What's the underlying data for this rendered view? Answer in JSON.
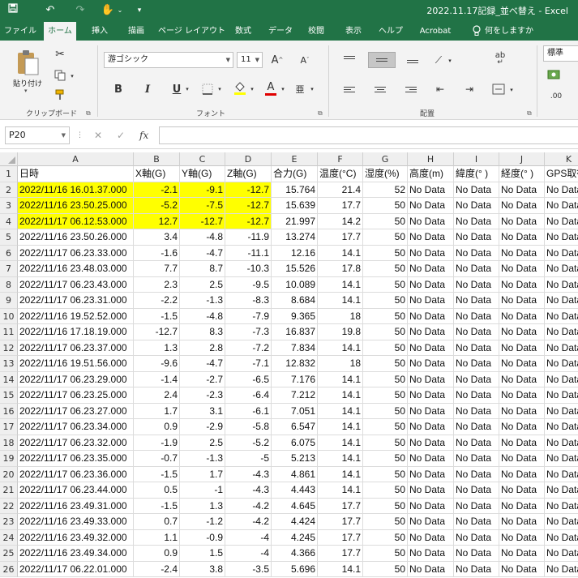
{
  "window": {
    "title": "2022.11.17記録_並べ替え  -  Excel",
    "qat": [
      "save-icon",
      "undo-icon",
      "redo-icon",
      "touch-mode-icon",
      "customize-qat-icon"
    ]
  },
  "ribbon": {
    "tabs": [
      "ファイル",
      "ホーム",
      "挿入",
      "描画",
      "ページ レイアウト",
      "数式",
      "データ",
      "校閲",
      "表示",
      "ヘルプ",
      "Acrobat",
      "何をしますか"
    ],
    "active_tab": "ホーム",
    "clipboard": {
      "label": "クリップボード",
      "paste_label": "貼り付け"
    },
    "font": {
      "label": "フォント",
      "name": "游ゴシック",
      "size": "11",
      "bold": "B",
      "italic": "I",
      "underline": "U",
      "grow": "A",
      "shrink": "A",
      "font_color": "A",
      "phonetic": "亜"
    },
    "alignment": {
      "label": "配置",
      "wrap": "ab",
      "merge": "⇔"
    },
    "number": {
      "format": "標準",
      "decimal": ".00"
    }
  },
  "formula_bar": {
    "name_box": "P20",
    "cancel": "✕",
    "enter": "✓",
    "fx": "fx",
    "value": ""
  },
  "sheet": {
    "columns": [
      "A",
      "B",
      "C",
      "D",
      "E",
      "F",
      "G",
      "H",
      "I",
      "J",
      "K"
    ],
    "headers": [
      "日時",
      "X軸(G)",
      "Y軸(G)",
      "Z軸(G)",
      "合力(G)",
      "温度(°C)",
      "湿度(%)",
      "高度(m)",
      "緯度(° )",
      "経度(° )",
      "GPS取得"
    ],
    "highlight_color": "#ffff00",
    "rows": [
      {
        "n": "2",
        "hl": true,
        "c": [
          "2022/11/16 16.01.37.000",
          "-2.1",
          "-9.1",
          "-12.7",
          "15.764",
          "21.4",
          "52",
          "No Data",
          "No Data",
          "No Data",
          "No Data"
        ]
      },
      {
        "n": "3",
        "hl": true,
        "c": [
          "2022/11/16 23.50.25.000",
          "-5.2",
          "-7.5",
          "-12.7",
          "15.639",
          "17.7",
          "50",
          "No Data",
          "No Data",
          "No Data",
          "No Data"
        ]
      },
      {
        "n": "4",
        "hl": true,
        "c": [
          "2022/11/17 06.12.53.000",
          "12.7",
          "-12.7",
          "-12.7",
          "21.997",
          "14.2",
          "50",
          "No Data",
          "No Data",
          "No Data",
          "No Data"
        ]
      },
      {
        "n": "5",
        "hl": false,
        "c": [
          "2022/11/16 23.50.26.000",
          "3.4",
          "-4.8",
          "-11.9",
          "13.274",
          "17.7",
          "50",
          "No Data",
          "No Data",
          "No Data",
          "No Data"
        ]
      },
      {
        "n": "6",
        "hl": false,
        "c": [
          "2022/11/17 06.23.33.000",
          "-1.6",
          "-4.7",
          "-11.1",
          "12.16",
          "14.1",
          "50",
          "No Data",
          "No Data",
          "No Data",
          "No Data"
        ]
      },
      {
        "n": "7",
        "hl": false,
        "c": [
          "2022/11/16 23.48.03.000",
          "7.7",
          "8.7",
          "-10.3",
          "15.526",
          "17.8",
          "50",
          "No Data",
          "No Data",
          "No Data",
          "No Data"
        ]
      },
      {
        "n": "8",
        "hl": false,
        "c": [
          "2022/11/17 06.23.43.000",
          "2.3",
          "2.5",
          "-9.5",
          "10.089",
          "14.1",
          "50",
          "No Data",
          "No Data",
          "No Data",
          "No Data"
        ]
      },
      {
        "n": "9",
        "hl": false,
        "c": [
          "2022/11/17 06.23.31.000",
          "-2.2",
          "-1.3",
          "-8.3",
          "8.684",
          "14.1",
          "50",
          "No Data",
          "No Data",
          "No Data",
          "No Data"
        ]
      },
      {
        "n": "10",
        "hl": false,
        "c": [
          "2022/11/16 19.52.52.000",
          "-1.5",
          "-4.8",
          "-7.9",
          "9.365",
          "18",
          "50",
          "No Data",
          "No Data",
          "No Data",
          "No Data"
        ]
      },
      {
        "n": "11",
        "hl": false,
        "c": [
          "2022/11/16 17.18.19.000",
          "-12.7",
          "8.3",
          "-7.3",
          "16.837",
          "19.8",
          "50",
          "No Data",
          "No Data",
          "No Data",
          "No Data"
        ]
      },
      {
        "n": "12",
        "hl": false,
        "c": [
          "2022/11/17 06.23.37.000",
          "1.3",
          "2.8",
          "-7.2",
          "7.834",
          "14.1",
          "50",
          "No Data",
          "No Data",
          "No Data",
          "No Data"
        ]
      },
      {
        "n": "13",
        "hl": false,
        "c": [
          "2022/11/16 19.51.56.000",
          "-9.6",
          "-4.7",
          "-7.1",
          "12.832",
          "18",
          "50",
          "No Data",
          "No Data",
          "No Data",
          "No Data"
        ]
      },
      {
        "n": "14",
        "hl": false,
        "c": [
          "2022/11/17 06.23.29.000",
          "-1.4",
          "-2.7",
          "-6.5",
          "7.176",
          "14.1",
          "50",
          "No Data",
          "No Data",
          "No Data",
          "No Data"
        ]
      },
      {
        "n": "15",
        "hl": false,
        "c": [
          "2022/11/17 06.23.25.000",
          "2.4",
          "-2.3",
          "-6.4",
          "7.212",
          "14.1",
          "50",
          "No Data",
          "No Data",
          "No Data",
          "No Data"
        ]
      },
      {
        "n": "16",
        "hl": false,
        "c": [
          "2022/11/17 06.23.27.000",
          "1.7",
          "3.1",
          "-6.1",
          "7.051",
          "14.1",
          "50",
          "No Data",
          "No Data",
          "No Data",
          "No Data"
        ]
      },
      {
        "n": "17",
        "hl": false,
        "c": [
          "2022/11/17 06.23.34.000",
          "0.9",
          "-2.9",
          "-5.8",
          "6.547",
          "14.1",
          "50",
          "No Data",
          "No Data",
          "No Data",
          "No Data"
        ]
      },
      {
        "n": "18",
        "hl": false,
        "c": [
          "2022/11/17 06.23.32.000",
          "-1.9",
          "2.5",
          "-5.2",
          "6.075",
          "14.1",
          "50",
          "No Data",
          "No Data",
          "No Data",
          "No Data"
        ]
      },
      {
        "n": "19",
        "hl": false,
        "c": [
          "2022/11/17 06.23.35.000",
          "-0.7",
          "-1.3",
          "-5",
          "5.213",
          "14.1",
          "50",
          "No Data",
          "No Data",
          "No Data",
          "No Data"
        ]
      },
      {
        "n": "20",
        "hl": false,
        "c": [
          "2022/11/17 06.23.36.000",
          "-1.5",
          "1.7",
          "-4.3",
          "4.861",
          "14.1",
          "50",
          "No Data",
          "No Data",
          "No Data",
          "No Data"
        ]
      },
      {
        "n": "21",
        "hl": false,
        "c": [
          "2022/11/17 06.23.44.000",
          "0.5",
          "-1",
          "-4.3",
          "4.443",
          "14.1",
          "50",
          "No Data",
          "No Data",
          "No Data",
          "No Data"
        ]
      },
      {
        "n": "22",
        "hl": false,
        "c": [
          "2022/11/16 23.49.31.000",
          "-1.5",
          "1.3",
          "-4.2",
          "4.645",
          "17.7",
          "50",
          "No Data",
          "No Data",
          "No Data",
          "No Data"
        ]
      },
      {
        "n": "23",
        "hl": false,
        "c": [
          "2022/11/16 23.49.33.000",
          "0.7",
          "-1.2",
          "-4.2",
          "4.424",
          "17.7",
          "50",
          "No Data",
          "No Data",
          "No Data",
          "No Data"
        ]
      },
      {
        "n": "24",
        "hl": false,
        "c": [
          "2022/11/16 23.49.32.000",
          "1.1",
          "-0.9",
          "-4",
          "4.245",
          "17.7",
          "50",
          "No Data",
          "No Data",
          "No Data",
          "No Data"
        ]
      },
      {
        "n": "25",
        "hl": false,
        "c": [
          "2022/11/16 23.49.34.000",
          "0.9",
          "1.5",
          "-4",
          "4.366",
          "17.7",
          "50",
          "No Data",
          "No Data",
          "No Data",
          "No Data"
        ]
      },
      {
        "n": "26",
        "hl": false,
        "c": [
          "2022/11/17 06.22.01.000",
          "-2.4",
          "3.8",
          "-3.5",
          "5.696",
          "14.1",
          "50",
          "No Data",
          "No Data",
          "No Data",
          "No Data"
        ]
      }
    ]
  }
}
